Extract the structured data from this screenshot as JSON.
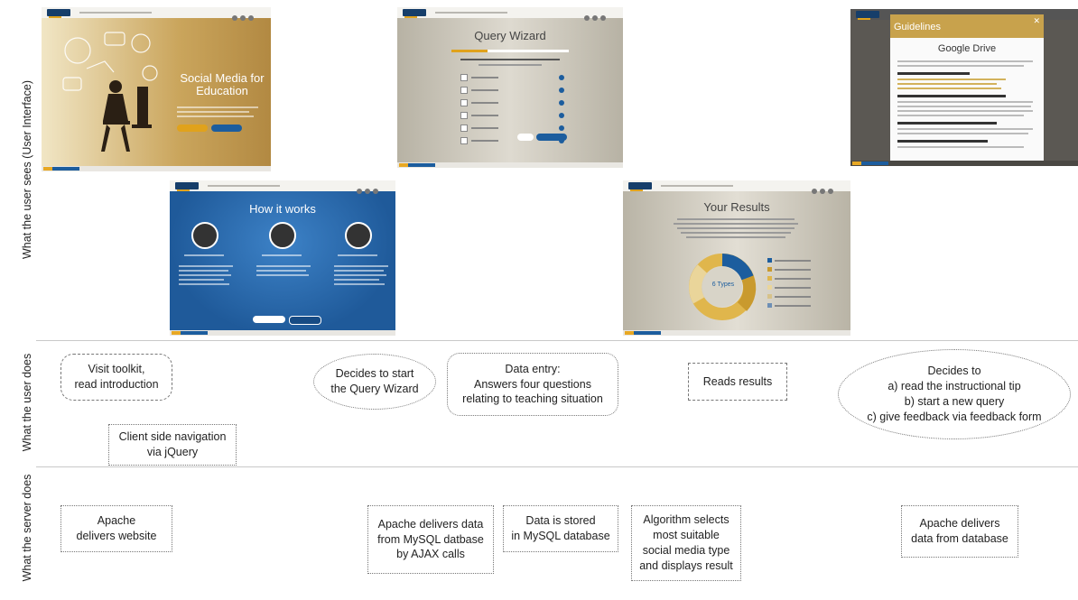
{
  "lanes": {
    "user_sees": "What the user sees (User Interface)",
    "user_does": "What the user does",
    "server_does": "What the server does"
  },
  "screens": {
    "home": {
      "title": "Social Media for Education"
    },
    "wizard": {
      "title": "Query Wizard"
    },
    "guidelines": {
      "header": "Guidelines",
      "title": "Google Drive"
    },
    "how": {
      "title": "How it works"
    },
    "results": {
      "title": "Your Results",
      "donut_label": "6 Types"
    }
  },
  "user_actions": {
    "visit": "Visit toolkit,\nread introduction",
    "decides_start": "Decides to start\nthe Query Wizard",
    "data_entry": "Data entry:\nAnswers four questions\nrelating to teaching situation",
    "reads": "Reads results",
    "decides_to": "Decides to\na) read the instructional tip\nb) start a new query\nc) give feedback via feedback form",
    "client_nav": "Client side navigation\nvia jQuery"
  },
  "server_actions": {
    "apache_website": "Apache\ndelivers website",
    "apache_ajax": "Apache delivers data\nfrom MySQL datbase\nby AJAX calls",
    "stored": "Data is stored\nin MySQL database",
    "algorithm": "Algorithm selects\nmost suitable\nsocial media type\nand displays result",
    "apache_db": "Apache delivers\ndata from database"
  },
  "colors": {
    "brand_blue": "#1c5d9e",
    "accent_yellow": "#e0a21c",
    "dark_navy": "#163e6a"
  }
}
